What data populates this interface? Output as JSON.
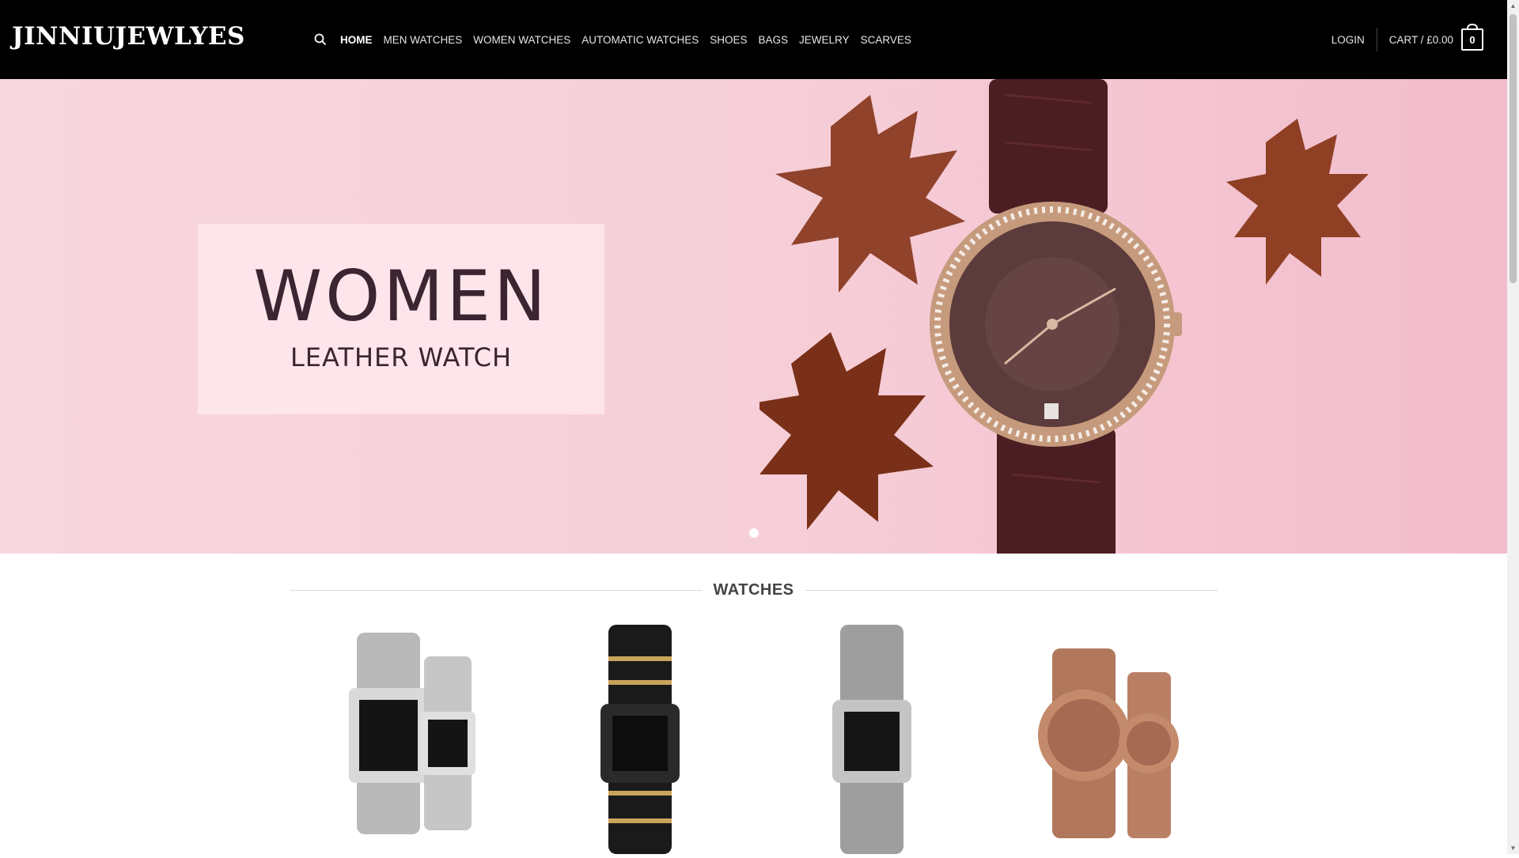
{
  "header": {
    "logo": "JINNIUJEWLYES",
    "nav": [
      {
        "label": "HOME",
        "active": true
      },
      {
        "label": "MEN WATCHES",
        "active": false
      },
      {
        "label": "WOMEN WATCHES",
        "active": false
      },
      {
        "label": "AUTOMATIC WATCHES",
        "active": false
      },
      {
        "label": "SHOES",
        "active": false
      },
      {
        "label": "BAGS",
        "active": false
      },
      {
        "label": "JEWELRY",
        "active": false
      },
      {
        "label": "SCARVES",
        "active": false
      }
    ],
    "login": "LOGIN",
    "cart_label": "CART / £0.00",
    "cart_count": "0"
  },
  "hero": {
    "title": "WOMEN",
    "subtitle": "LEATHER WATCH"
  },
  "section": {
    "title": "WATCHES"
  },
  "products": [
    {
      "image": "silver-pair-watch"
    },
    {
      "image": "black-gold-watch"
    },
    {
      "image": "silver-square-watch"
    },
    {
      "image": "rose-gold-pair-watch"
    }
  ],
  "icons": {
    "search": "search-icon",
    "cart": "cart-bag-icon"
  },
  "colors": {
    "header_bg": "#000000",
    "hero_bg": "#f6cfd8",
    "text_dark": "#3a2530"
  }
}
